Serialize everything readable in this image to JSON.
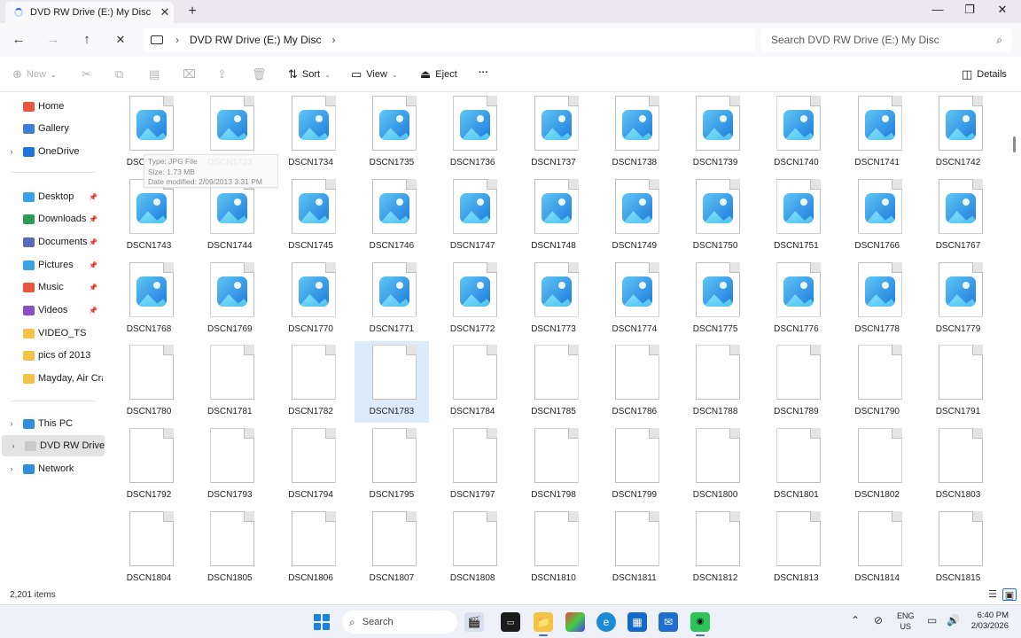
{
  "window": {
    "tab_title": "DVD RW Drive (E:) My Disc",
    "tab_close": "✕",
    "new_tab": "+",
    "minimize": "—",
    "restore": "❐",
    "close": "✕"
  },
  "nav": {
    "back": "←",
    "forward": "→",
    "up": "↑",
    "stop": "✕",
    "breadcrumb": [
      "DVD RW Drive (E:) My Disc"
    ],
    "breadcrumb_sep": "›",
    "search_placeholder": "Search DVD RW Drive (E:) My Disc"
  },
  "toolbar": {
    "new_label": "New",
    "sort_label": "Sort",
    "view_label": "View",
    "eject_label": "Eject",
    "more_label": "···",
    "details_label": "Details"
  },
  "sidebar": {
    "items": [
      {
        "label": "Home",
        "icon": "home-icon",
        "color": "#e8563f",
        "expand": false,
        "pin": false,
        "selected": false
      },
      {
        "label": "Gallery",
        "icon": "gallery-icon",
        "color": "#3d7fd9",
        "expand": false,
        "pin": false,
        "selected": false
      },
      {
        "label": "OneDrive",
        "icon": "cloud-icon",
        "color": "#1e73d6",
        "expand": true,
        "pin": false,
        "selected": false
      },
      {
        "label": "Desktop",
        "icon": "desktop-icon",
        "color": "#3aa0e8",
        "expand": false,
        "pin": true,
        "selected": false
      },
      {
        "label": "Downloads",
        "icon": "download-icon",
        "color": "#2f9b54",
        "expand": false,
        "pin": true,
        "selected": false
      },
      {
        "label": "Documents",
        "icon": "documents-icon",
        "color": "#5b6ab8",
        "expand": false,
        "pin": true,
        "selected": false
      },
      {
        "label": "Pictures",
        "icon": "pictures-icon",
        "color": "#3aa3e0",
        "expand": false,
        "pin": true,
        "selected": false
      },
      {
        "label": "Music",
        "icon": "music-icon",
        "color": "#e8563f",
        "expand": false,
        "pin": true,
        "selected": false
      },
      {
        "label": "Videos",
        "icon": "videos-icon",
        "color": "#8a4fc7",
        "expand": false,
        "pin": true,
        "selected": false
      },
      {
        "label": "VIDEO_TS",
        "icon": "folder-icon",
        "color": "#f4c246",
        "expand": false,
        "pin": false,
        "selected": false
      },
      {
        "label": "pics of 2013",
        "icon": "folder-icon",
        "color": "#f4c246",
        "expand": false,
        "pin": false,
        "selected": false
      },
      {
        "label": "Mayday, Air Cras",
        "icon": "folder-icon",
        "color": "#f4c246",
        "expand": false,
        "pin": false,
        "selected": false
      },
      {
        "label": "This PC",
        "icon": "pc-icon",
        "color": "#2f8fd8",
        "expand": true,
        "pin": false,
        "selected": false
      },
      {
        "label": "DVD RW Drive (E",
        "icon": "dvd-icon",
        "color": "#c9c9c9",
        "expand": true,
        "pin": false,
        "selected": true
      },
      {
        "label": "Network",
        "icon": "network-icon",
        "color": "#2f8fd8",
        "expand": true,
        "pin": false,
        "selected": false
      }
    ],
    "expand_glyph": "›",
    "pin_glyph": "📌"
  },
  "files": [
    {
      "name": "DSCN1732",
      "type": "image"
    },
    {
      "name": "DSCN1733",
      "type": "image"
    },
    {
      "name": "DSCN1734",
      "type": "image"
    },
    {
      "name": "DSCN1735",
      "type": "image"
    },
    {
      "name": "DSCN1736",
      "type": "image"
    },
    {
      "name": "DSCN1737",
      "type": "image"
    },
    {
      "name": "DSCN1738",
      "type": "image"
    },
    {
      "name": "DSCN1739",
      "type": "image"
    },
    {
      "name": "DSCN1740",
      "type": "image"
    },
    {
      "name": "DSCN1741",
      "type": "image"
    },
    {
      "name": "DSCN1742",
      "type": "image"
    },
    {
      "name": "DSCN1743",
      "type": "image"
    },
    {
      "name": "DSCN1744",
      "type": "image"
    },
    {
      "name": "DSCN1745",
      "type": "image"
    },
    {
      "name": "DSCN1746",
      "type": "image"
    },
    {
      "name": "DSCN1747",
      "type": "image"
    },
    {
      "name": "DSCN1748",
      "type": "image"
    },
    {
      "name": "DSCN1749",
      "type": "image"
    },
    {
      "name": "DSCN1750",
      "type": "image"
    },
    {
      "name": "DSCN1751",
      "type": "image"
    },
    {
      "name": "DSCN1766",
      "type": "image"
    },
    {
      "name": "DSCN1767",
      "type": "image"
    },
    {
      "name": "DSCN1768",
      "type": "image"
    },
    {
      "name": "DSCN1769",
      "type": "image"
    },
    {
      "name": "DSCN1770",
      "type": "image"
    },
    {
      "name": "DSCN1771",
      "type": "image"
    },
    {
      "name": "DSCN1772",
      "type": "image"
    },
    {
      "name": "DSCN1773",
      "type": "image"
    },
    {
      "name": "DSCN1774",
      "type": "image"
    },
    {
      "name": "DSCN1775",
      "type": "image"
    },
    {
      "name": "DSCN1776",
      "type": "image"
    },
    {
      "name": "DSCN1778",
      "type": "image"
    },
    {
      "name": "DSCN1779",
      "type": "image"
    },
    {
      "name": "DSCN1780",
      "type": "blank"
    },
    {
      "name": "DSCN1781",
      "type": "blank"
    },
    {
      "name": "DSCN1782",
      "type": "blank"
    },
    {
      "name": "DSCN1783",
      "type": "blank",
      "hover": true
    },
    {
      "name": "DSCN1784",
      "type": "blank"
    },
    {
      "name": "DSCN1785",
      "type": "blank"
    },
    {
      "name": "DSCN1786",
      "type": "blank"
    },
    {
      "name": "DSCN1788",
      "type": "blank"
    },
    {
      "name": "DSCN1789",
      "type": "blank"
    },
    {
      "name": "DSCN1790",
      "type": "blank"
    },
    {
      "name": "DSCN1791",
      "type": "blank"
    },
    {
      "name": "DSCN1792",
      "type": "blank"
    },
    {
      "name": "DSCN1793",
      "type": "blank"
    },
    {
      "name": "DSCN1794",
      "type": "blank"
    },
    {
      "name": "DSCN1795",
      "type": "blank"
    },
    {
      "name": "DSCN1797",
      "type": "blank"
    },
    {
      "name": "DSCN1798",
      "type": "blank"
    },
    {
      "name": "DSCN1799",
      "type": "blank"
    },
    {
      "name": "DSCN1800",
      "type": "blank"
    },
    {
      "name": "DSCN1801",
      "type": "blank"
    },
    {
      "name": "DSCN1802",
      "type": "blank"
    },
    {
      "name": "DSCN1803",
      "type": "blank"
    },
    {
      "name": "DSCN1804",
      "type": "blank"
    },
    {
      "name": "DSCN1805",
      "type": "blank"
    },
    {
      "name": "DSCN1806",
      "type": "blank"
    },
    {
      "name": "DSCN1807",
      "type": "blank"
    },
    {
      "name": "DSCN1808",
      "type": "blank"
    },
    {
      "name": "DSCN1810",
      "type": "blank"
    },
    {
      "name": "DSCN1811",
      "type": "blank"
    },
    {
      "name": "DSCN1812",
      "type": "blank"
    },
    {
      "name": "DSCN1813",
      "type": "blank"
    },
    {
      "name": "DSCN1814",
      "type": "blank"
    },
    {
      "name": "DSCN1815",
      "type": "blank"
    }
  ],
  "tooltip": {
    "type_line": "Type: JPG File",
    "size_line": "Size: 1.73 MB",
    "date_line": "Date modified: 2/09/2013 3:31 PM"
  },
  "status": {
    "item_count": "2,201 items"
  },
  "taskbar": {
    "search_label": "Search",
    "lang_top": "ENG",
    "lang_bottom": "US",
    "time": "6:40 PM",
    "date": "2/03/2026"
  }
}
